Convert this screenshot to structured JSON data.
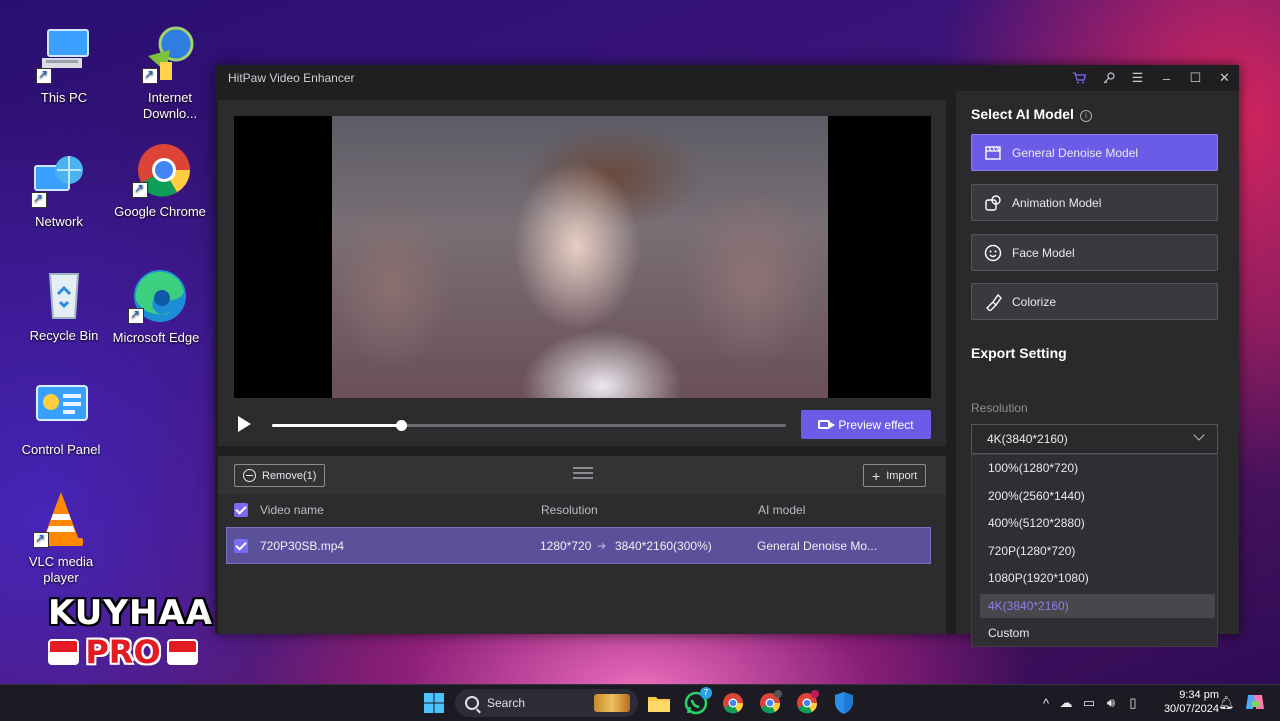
{
  "desktop": {
    "icons": [
      {
        "label": "This PC"
      },
      {
        "label": "Internet Downlo..."
      },
      {
        "label": "Network"
      },
      {
        "label": "Google Chrome"
      },
      {
        "label": "Recycle Bin"
      },
      {
        "label": "Microsoft Edge"
      },
      {
        "label": "Control Panel"
      },
      {
        "label": "VLC media player"
      }
    ],
    "watermark": {
      "line1": "KUYHAA",
      "line2": "PRO"
    }
  },
  "window": {
    "title": "HitPaw Video Enhancer",
    "controls": [
      "cart-icon",
      "key-icon",
      "menu-icon",
      "minimize-icon",
      "maximize-icon",
      "close-icon"
    ]
  },
  "player": {
    "progress": 0.25,
    "preview_label": "Preview effect"
  },
  "file_list": {
    "remove_label": "Remove(1)",
    "import_label": "Import",
    "columns": {
      "name": "Video name",
      "resolution": "Resolution",
      "model": "AI model"
    },
    "rows": [
      {
        "name": "720P30SB.mp4",
        "from": "1280*720",
        "to": "3840*2160(300%)",
        "model": "General Denoise Mo..."
      }
    ]
  },
  "sidebar": {
    "model_title": "Select AI Model",
    "models": [
      {
        "label": "General Denoise Model",
        "icon": "film-icon",
        "active": true
      },
      {
        "label": "Animation Model",
        "icon": "animation-icon",
        "active": false
      },
      {
        "label": "Face Model",
        "icon": "face-icon",
        "active": false
      },
      {
        "label": "Colorize",
        "icon": "brush-icon",
        "active": false
      }
    ],
    "export_title": "Export Setting",
    "resolution_label": "Resolution",
    "resolution_value": "4K(3840*2160)",
    "resolution_options": [
      "100%(1280*720)",
      "200%(2560*1440)",
      "400%(5120*2880)",
      "720P(1280*720)",
      "1080P(1920*1080)",
      "4K(3840*2160)",
      "Custom"
    ],
    "selected_index": 5
  },
  "taskbar": {
    "search_placeholder": "Search",
    "whatsapp_badge": "7",
    "time": "9:34 pm",
    "date": "30/07/2024"
  },
  "colors": {
    "accent": "#6b5ce7",
    "window_bg": "#1f1f21",
    "panel_bg": "#2c2c2f"
  }
}
